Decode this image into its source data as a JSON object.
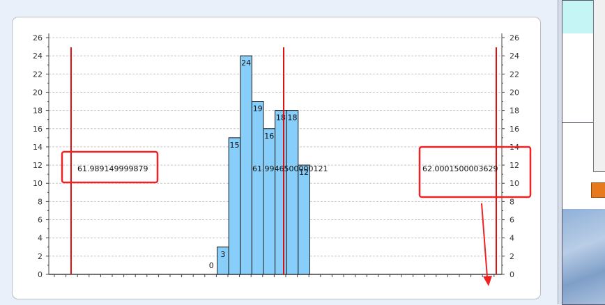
{
  "chart_data": {
    "type": "bar",
    "title": "",
    "xlabel": "",
    "ylabel": "",
    "ylim": [
      0,
      26
    ],
    "yticks": [
      0,
      2,
      4,
      6,
      8,
      10,
      12,
      14,
      16,
      18,
      20,
      22,
      24,
      26
    ],
    "grid": true,
    "bars": [
      {
        "label": "0",
        "value": 0
      },
      {
        "label": "3",
        "value": 3
      },
      {
        "label": "15",
        "value": 15
      },
      {
        "label": "24",
        "value": 24
      },
      {
        "label": "19",
        "value": 19
      },
      {
        "label": "16",
        "value": 16
      },
      {
        "label": "18",
        "value": 18
      },
      {
        "label": "18",
        "value": 18
      },
      {
        "label": "12",
        "value": 12
      }
    ],
    "reference_lines": [
      {
        "label": "61.989149999879",
        "value": 61.989149999879
      },
      {
        "label": "61.9946500000121",
        "value": 61.9946500000121
      },
      {
        "label": "62.0001500003629",
        "value": 62.0001500003629
      }
    ],
    "colors": {
      "bar_fill": "#87cefa",
      "bar_stroke": "#1a1a1a",
      "ref_line": "#dd1111",
      "highlight_box": "#ee2222",
      "grid": "#c8c8c8"
    }
  }
}
